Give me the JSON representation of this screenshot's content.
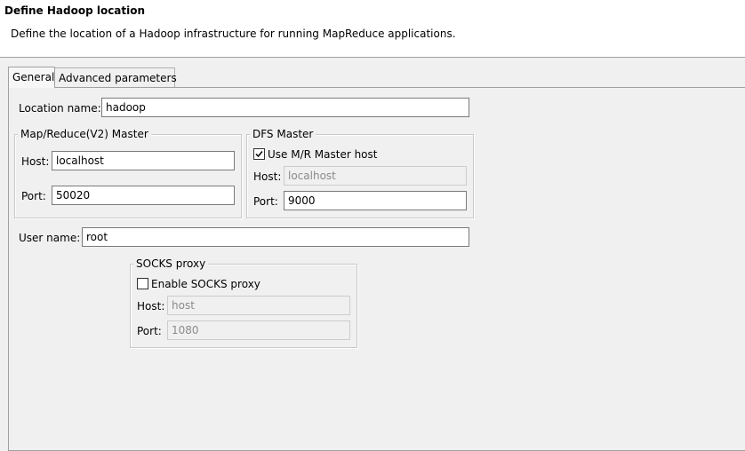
{
  "header": {
    "title": "Define Hadoop location",
    "description": "Define the location of a Hadoop infrastructure for running MapReduce applications."
  },
  "tabs": [
    {
      "label": "General",
      "active": true
    },
    {
      "label": "Advanced parameters",
      "active": false
    }
  ],
  "general": {
    "location_name_label": "Location name:",
    "location_name_value": "hadoop",
    "mr_master": {
      "title": "Map/Reduce(V2) Master",
      "host_label": "Host:",
      "host_value": "localhost",
      "port_label": "Port:",
      "port_value": "50020"
    },
    "dfs_master": {
      "title": "DFS Master",
      "use_mr_host_label": "Use M/R Master host",
      "use_mr_host_checked": true,
      "host_label": "Host:",
      "host_value": "localhost",
      "port_label": "Port:",
      "port_value": "9000"
    },
    "user_name_label": "User name:",
    "user_name_value": "root",
    "socks_proxy": {
      "title": "SOCKS proxy",
      "enable_label": "Enable SOCKS proxy",
      "enable_checked": false,
      "host_label": "Host:",
      "host_value": "host",
      "port_label": "Port:",
      "port_value": "1080"
    }
  }
}
